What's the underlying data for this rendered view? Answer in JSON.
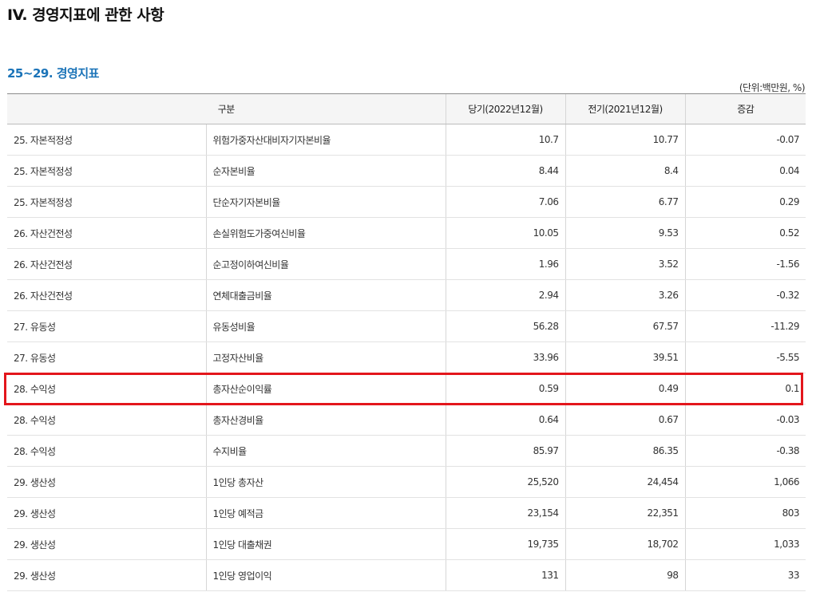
{
  "page_title": "IV. 경영지표에 관한 사항",
  "section_title": "25~29. 경영지표",
  "unit_note": "(단위:백만원, %)",
  "table": {
    "headers": {
      "category": "구분",
      "current": "당기(2022년12월)",
      "previous": "전기(2021년12월)",
      "change": "증감"
    },
    "rows": [
      {
        "group": "25. 자본적정성",
        "item": "위험가중자산대비자기자본비율",
        "current": "10.7",
        "previous": "10.77",
        "change": "-0.07"
      },
      {
        "group": "25. 자본적정성",
        "item": "순자본비율",
        "current": "8.44",
        "previous": "8.4",
        "change": "0.04"
      },
      {
        "group": "25. 자본적정성",
        "item": "단순자기자본비율",
        "current": "7.06",
        "previous": "6.77",
        "change": "0.29"
      },
      {
        "group": "26. 자산건전성",
        "item": "손실위험도가중여신비율",
        "current": "10.05",
        "previous": "9.53",
        "change": "0.52"
      },
      {
        "group": "26. 자산건전성",
        "item": "순고정이하여신비율",
        "current": "1.96",
        "previous": "3.52",
        "change": "-1.56"
      },
      {
        "group": "26. 자산건전성",
        "item": "연체대출금비율",
        "current": "2.94",
        "previous": "3.26",
        "change": "-0.32"
      },
      {
        "group": "27. 유동성",
        "item": "유동성비율",
        "current": "56.28",
        "previous": "67.57",
        "change": "-11.29"
      },
      {
        "group": "27. 유동성",
        "item": "고정자산비율",
        "current": "33.96",
        "previous": "39.51",
        "change": "-5.55"
      },
      {
        "group": "28. 수익성",
        "item": "총자산순이익률",
        "current": "0.59",
        "previous": "0.49",
        "change": "0.1"
      },
      {
        "group": "28. 수익성",
        "item": "총자산경비율",
        "current": "0.64",
        "previous": "0.67",
        "change": "-0.03"
      },
      {
        "group": "28. 수익성",
        "item": "수지비율",
        "current": "85.97",
        "previous": "86.35",
        "change": "-0.38"
      },
      {
        "group": "29. 생산성",
        "item": "1인당 총자산",
        "current": "25,520",
        "previous": "24,454",
        "change": "1,066"
      },
      {
        "group": "29. 생산성",
        "item": "1인당 예적금",
        "current": "23,154",
        "previous": "22,351",
        "change": "803"
      },
      {
        "group": "29. 생산성",
        "item": "1인당 대출채권",
        "current": "19,735",
        "previous": "18,702",
        "change": "1,033"
      },
      {
        "group": "29. 생산성",
        "item": "1인당 영업이익",
        "current": "131",
        "previous": "98",
        "change": "33"
      }
    ]
  },
  "highlight_color": "#e3161c",
  "accent_color": "#1a73b8"
}
